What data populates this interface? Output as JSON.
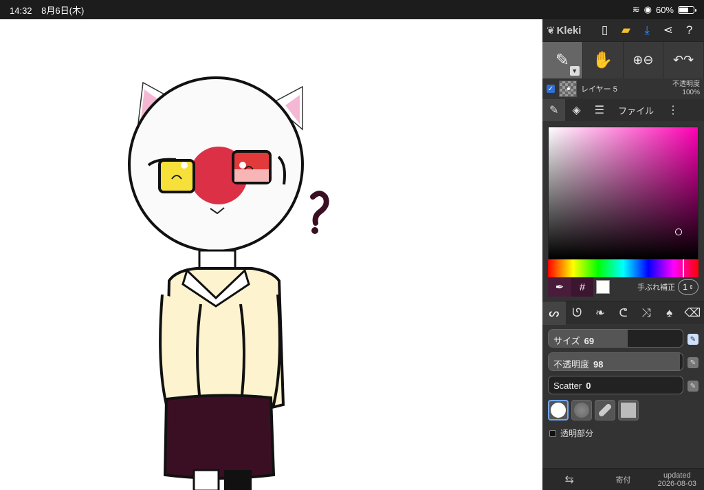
{
  "status": {
    "time": "14:32",
    "date": "8月6日(木)",
    "battery": "60%"
  },
  "app": {
    "name": "Kleki"
  },
  "layer": {
    "name": "レイヤー 5",
    "opacity_label": "不透明度",
    "opacity_value": "100%"
  },
  "tabs": {
    "file_label": "ファイル"
  },
  "color": {
    "stabilizer_label": "手ぶれ補正",
    "stabilizer_value": "1",
    "hash_symbol": "#"
  },
  "brush": {
    "size_label": "サイズ",
    "size_value": "69",
    "size_fraction": 0.59,
    "opacity_label": "不透明度",
    "opacity_value": "98",
    "opacity_fraction": 0.98,
    "scatter_label": "Scatter",
    "scatter_value": "0",
    "scatter_fraction": 0.0
  },
  "transparent_label": "透明部分",
  "bottom": {
    "donate_label": "寄付",
    "updated_label": "updated",
    "updated_date": "2026-08-03"
  },
  "colors": {
    "accent": "#2f6fd6",
    "skirt": "#3a0f24",
    "cardigan": "#fdf3cf",
    "nose": "#e03048"
  }
}
